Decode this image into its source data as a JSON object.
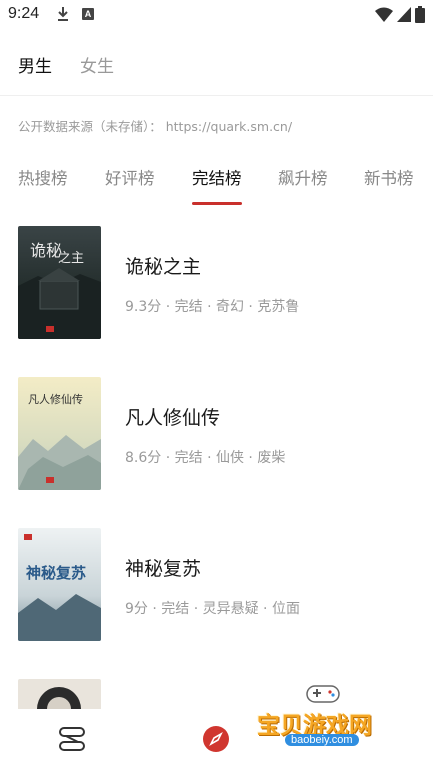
{
  "status_bar": {
    "time": "9:24"
  },
  "gender_tabs": [
    {
      "label": "男生",
      "active": true
    },
    {
      "label": "女生",
      "active": false
    }
  ],
  "source_line": "公开数据来源（未存储）： https://quark.sm.cn/",
  "rank_tabs": [
    {
      "label": "热搜榜",
      "active": false
    },
    {
      "label": "好评榜",
      "active": false
    },
    {
      "label": "完结榜",
      "active": true
    },
    {
      "label": "飙升榜",
      "active": false
    },
    {
      "label": "新书榜",
      "active": false
    }
  ],
  "books": [
    {
      "title": "诡秘之主",
      "meta": "9.3分 · 完结 · 奇幻 · 克苏鲁"
    },
    {
      "title": "凡人修仙传",
      "meta": "8.6分 · 完结 · 仙侠 · 废柴"
    },
    {
      "title": "神秘复苏",
      "meta": "9分 · 完结 · 灵异悬疑 · 位面"
    },
    {
      "title": "",
      "meta": ""
    }
  ],
  "bottom_nav": {
    "items": [
      "shelf-icon",
      "compass-icon"
    ]
  },
  "watermark": {
    "text": "宝贝游戏网",
    "url": "baobeiy.com"
  },
  "colors": {
    "accent": "#c9302c"
  }
}
